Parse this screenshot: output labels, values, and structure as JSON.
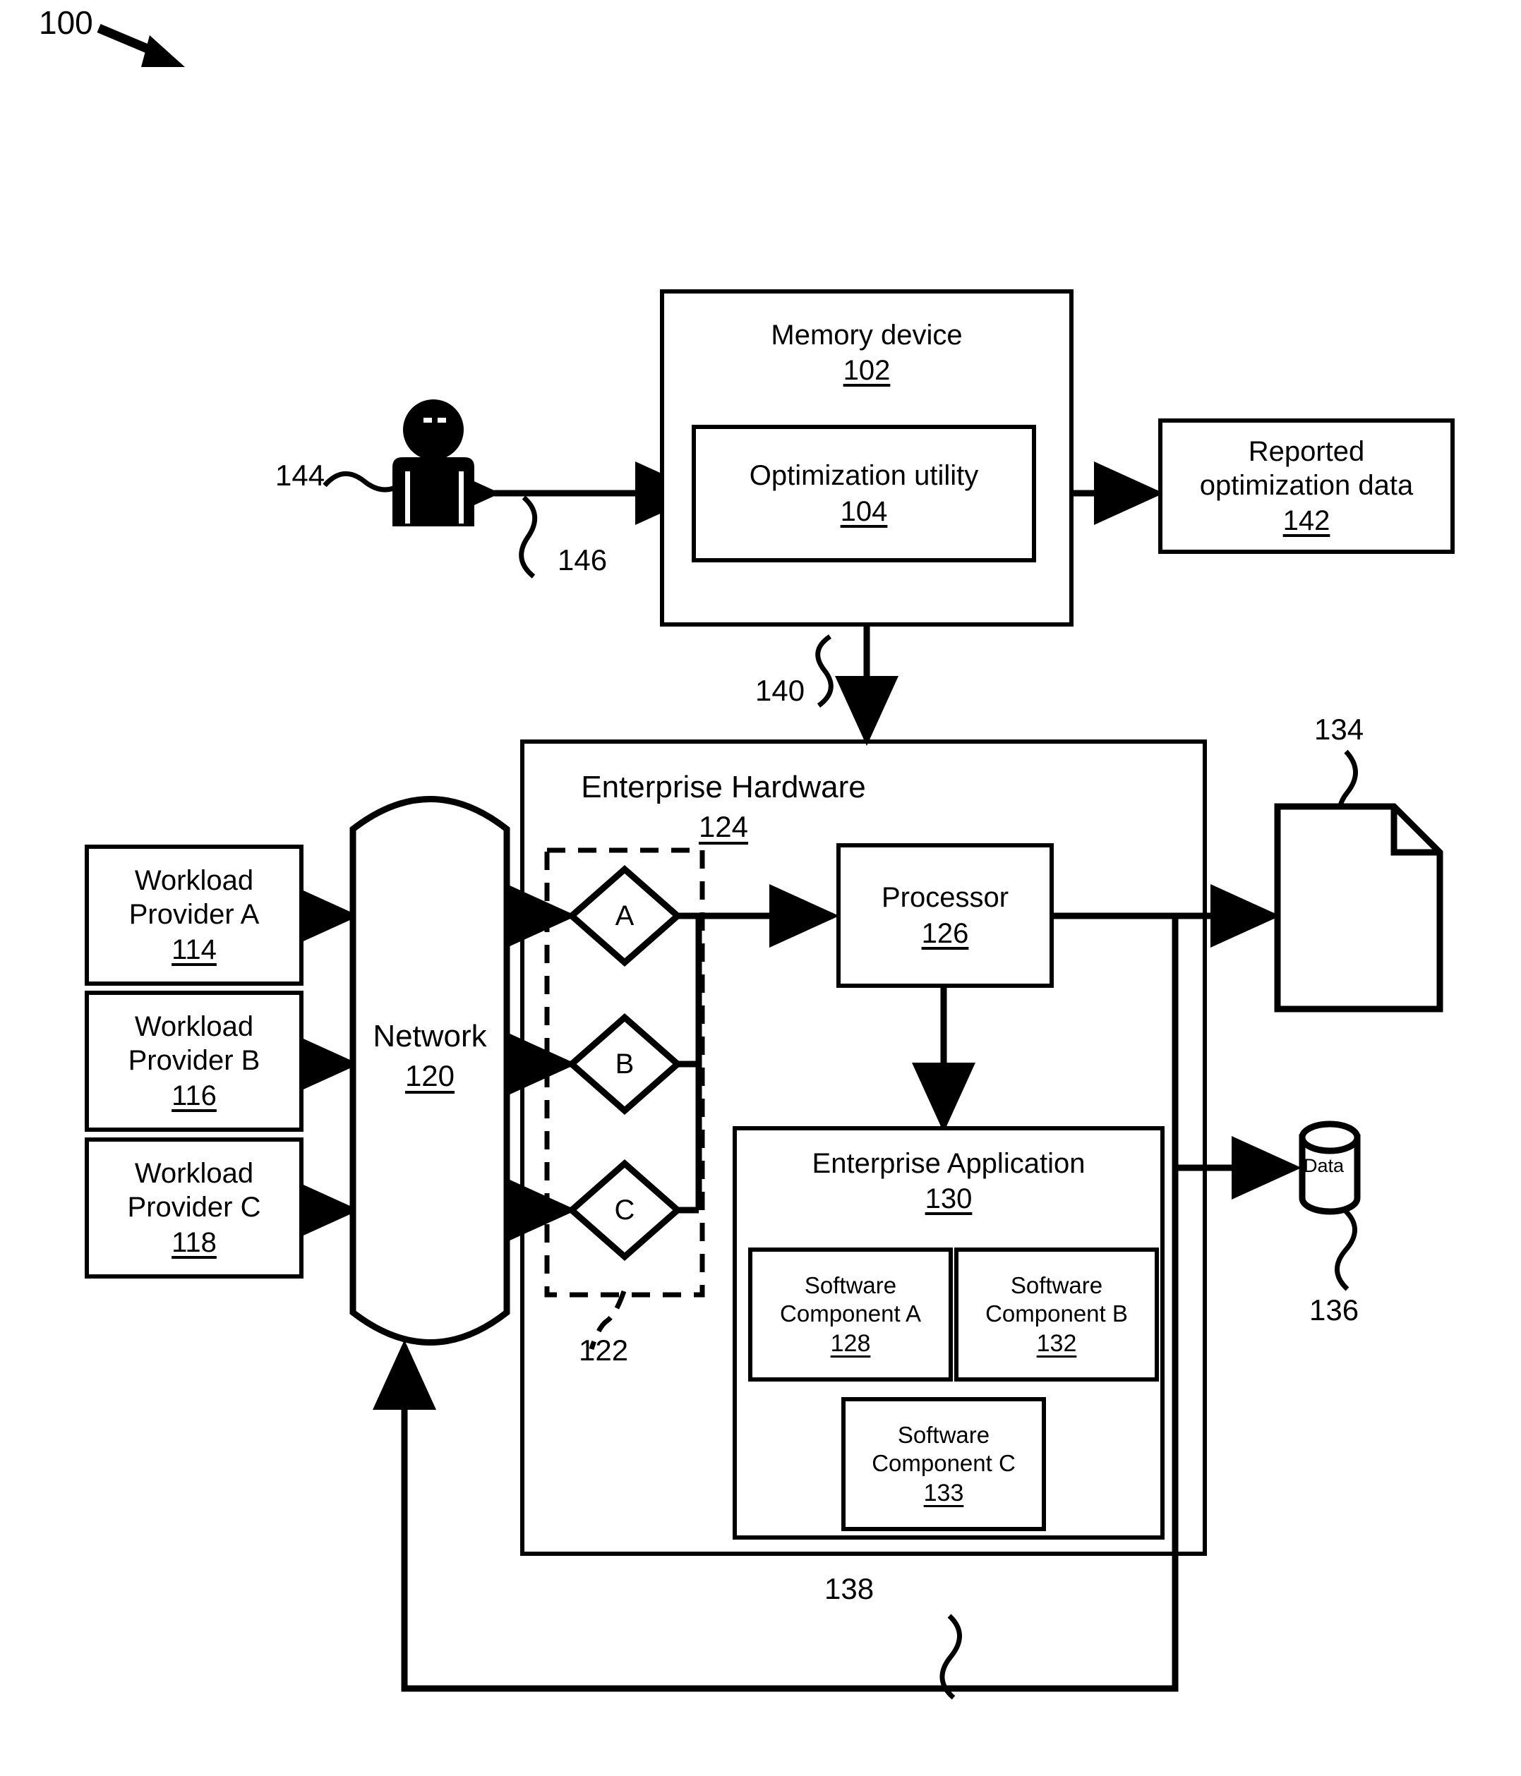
{
  "figure": {
    "ref_label": "100"
  },
  "memory_device": {
    "title": "Memory device",
    "number": "102",
    "utility": {
      "title": "Optimization utility",
      "number": "104"
    }
  },
  "user": {
    "ref": "144",
    "link_ref": "146",
    "icon": "person-icon"
  },
  "reported": {
    "title": "Reported\noptimization data",
    "number": "142"
  },
  "bus_140": {
    "ref": "140"
  },
  "enterprise_hardware": {
    "title": "Enterprise Hardware",
    "number": "124"
  },
  "workload_providers": [
    {
      "title": "Workload\nProvider A",
      "number": "114"
    },
    {
      "title": "Workload\nProvider B",
      "number": "116"
    },
    {
      "title": "Workload\nProvider C",
      "number": "118"
    }
  ],
  "network": {
    "title": "Network",
    "number": "120"
  },
  "queues": {
    "ref": "122",
    "items": [
      "A",
      "B",
      "C"
    ]
  },
  "processor": {
    "title": "Processor",
    "number": "126"
  },
  "enterprise_application": {
    "title": "Enterprise Application",
    "number": "130",
    "components": [
      {
        "title": "Software\nComponent A",
        "number": "128"
      },
      {
        "title": "Software\nComponent B",
        "number": "132"
      },
      {
        "title": "Software\nComponent C",
        "number": "133"
      }
    ]
  },
  "document_output": {
    "ref": "134"
  },
  "data_store": {
    "label": "Data",
    "ref": "136"
  },
  "feedback": {
    "ref": "138"
  },
  "colors": {
    "ink": "#000000",
    "paper": "#ffffff"
  }
}
